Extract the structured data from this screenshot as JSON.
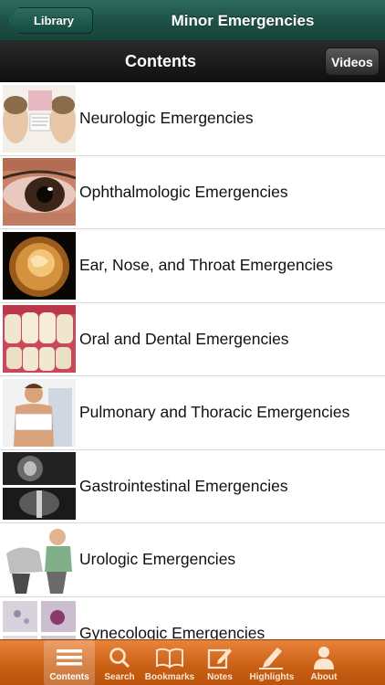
{
  "navbar": {
    "back_label": "Library",
    "title": "Minor Emergencies"
  },
  "subbar": {
    "title": "Contents",
    "videos_label": "Videos"
  },
  "chapters": [
    {
      "label": "Neurologic Emergencies",
      "thumb": "neurologic-illustration"
    },
    {
      "label": "Ophthalmologic Emergencies",
      "thumb": "eye-photo"
    },
    {
      "label": "Ear, Nose, and Throat Emergencies",
      "thumb": "ear-canal-photo"
    },
    {
      "label": "Oral and Dental Emergencies",
      "thumb": "teeth-photo"
    },
    {
      "label": "Pulmonary and Thoracic Emergencies",
      "thumb": "patient-illustration"
    },
    {
      "label": "Gastrointestinal Emergencies",
      "thumb": "xray-images"
    },
    {
      "label": "Urologic Emergencies",
      "thumb": "urologic-illustration"
    },
    {
      "label": "Gynecologic Emergencies",
      "thumb": "microscopy-images"
    }
  ],
  "tabs": [
    {
      "label": "Contents",
      "icon": "list-icon",
      "active": true
    },
    {
      "label": "Search",
      "icon": "search-icon"
    },
    {
      "label": "Bookmarks",
      "icon": "book-icon"
    },
    {
      "label": "Notes",
      "icon": "notes-icon"
    },
    {
      "label": "Highlights",
      "icon": "highlighter-icon"
    },
    {
      "label": "About",
      "icon": "person-icon"
    }
  ],
  "colors": {
    "navbar": "#1d4f45",
    "subbar": "#1a1a1a",
    "tabbar": "#c95f14"
  }
}
